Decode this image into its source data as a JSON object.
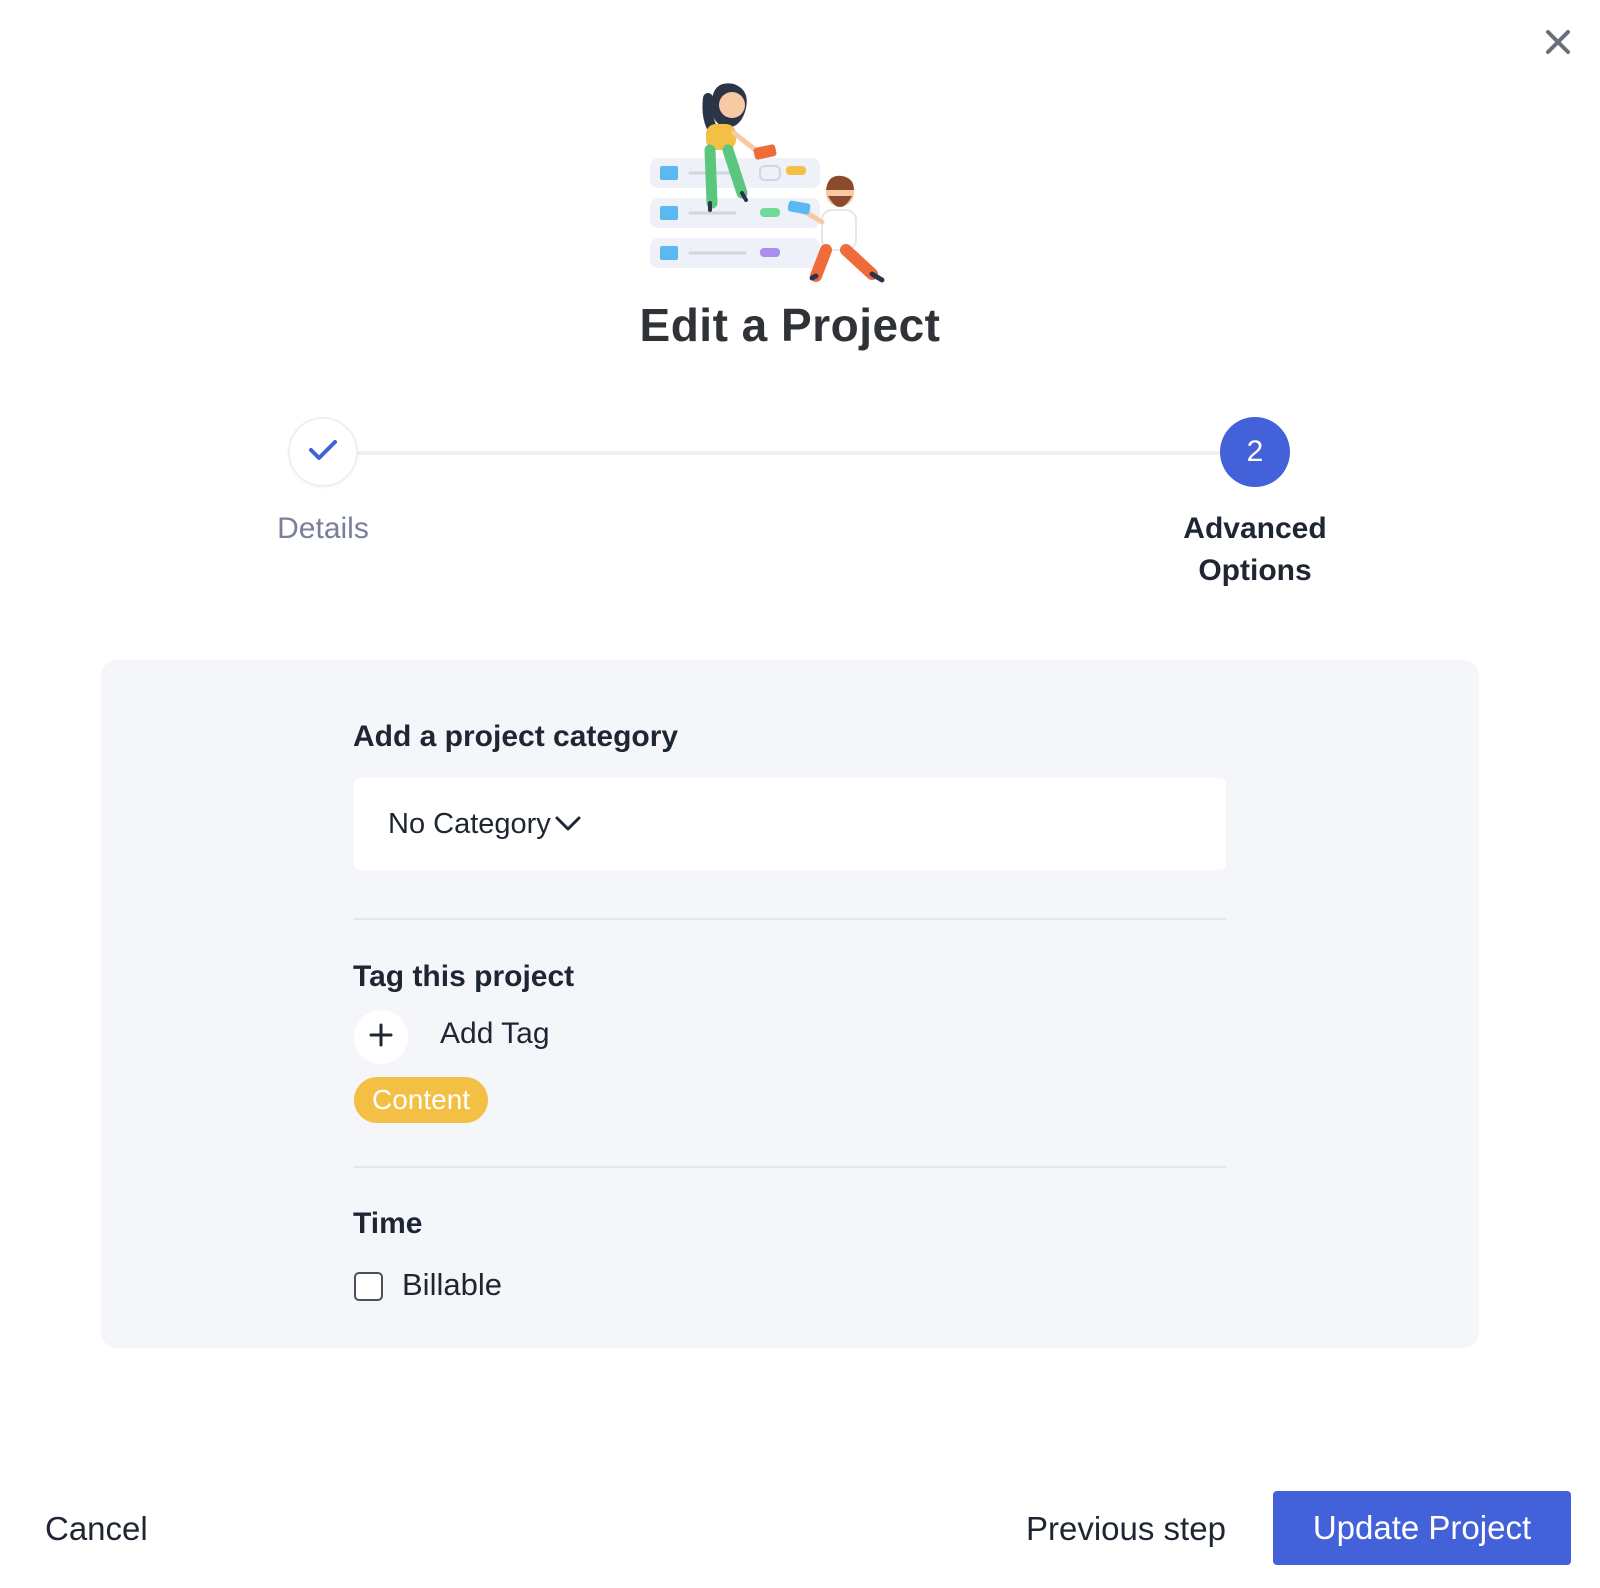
{
  "header": {
    "title": "Edit a Project",
    "close_icon": "close-icon",
    "illustration": "project-team-illustration"
  },
  "stepper": {
    "steps": [
      {
        "label": "Details",
        "state": "completed",
        "marker_icon": "check-icon"
      },
      {
        "label": "Advanced Options",
        "state": "active",
        "number": "2"
      }
    ],
    "active_color": "#4361d8"
  },
  "form": {
    "category": {
      "title": "Add a project category",
      "selected_value": "No Category",
      "icon": "chevron-down-icon"
    },
    "tags": {
      "title": "Tag this project",
      "add_label": "Add Tag",
      "add_icon": "plus-icon",
      "items": [
        {
          "label": "Content",
          "color": "#f4bf45"
        }
      ]
    },
    "time": {
      "title": "Time",
      "billable_label": "Billable",
      "billable_checked": false
    }
  },
  "footer": {
    "cancel_label": "Cancel",
    "previous_label": "Previous step",
    "submit_label": "Update Project",
    "submit_color": "#4361d8"
  }
}
